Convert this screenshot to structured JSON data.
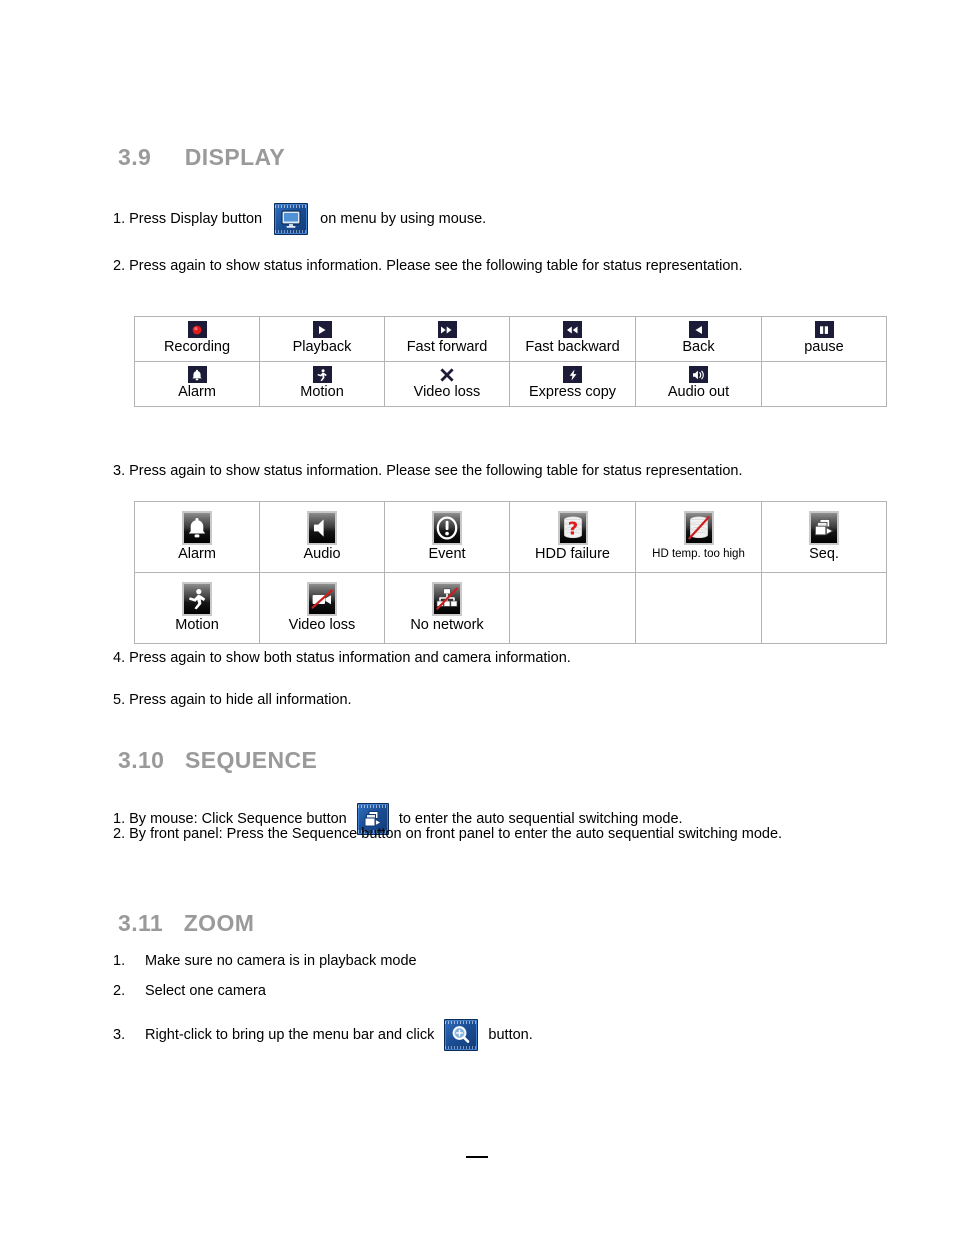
{
  "sections": {
    "display": {
      "number": "3.9",
      "title": "DISPLAY",
      "steps": {
        "s1_pre": "1. Press Display button",
        "s1_post": "on menu by using mouse.",
        "s2": "2. Press again to show status information. Please see the following table for status representation.",
        "s3": "3. Press again to show status information. Please see the following table for status representation.",
        "s4": "4. Press again to show both status information and camera information.",
        "s5": "5. Press again to hide all information."
      }
    },
    "sequence": {
      "number": "3.10",
      "title": "SEQUENCE",
      "steps": {
        "s1_pre": "1. By mouse: Click Sequence button",
        "s1_post": "to enter the auto sequential switching mode.",
        "s2": "2. By front panel: Press the Sequence button on front panel to enter the auto sequential switching mode."
      }
    },
    "zoom": {
      "number": "3.11",
      "title": "ZOOM",
      "steps": [
        {
          "marker": "1.",
          "text": "Make sure no camera is in playback mode"
        },
        {
          "marker": "2.",
          "text": "Select one camera"
        },
        {
          "marker": "3.",
          "pre": "Right-click to bring up the menu bar and click",
          "post": "button."
        }
      ]
    }
  },
  "table_status_1": {
    "rows": [
      [
        {
          "icon": "record-dot-icon",
          "label": "Recording"
        },
        {
          "icon": "play-icon",
          "label": "Playback"
        },
        {
          "icon": "fast-forward-icon",
          "label": "Fast forward"
        },
        {
          "icon": "fast-backward-icon",
          "label": "Fast backward"
        },
        {
          "icon": "back-icon",
          "label": "Back"
        },
        {
          "icon": "pause-icon",
          "label": "pause"
        }
      ],
      [
        {
          "icon": "bell-icon",
          "label": "Alarm"
        },
        {
          "icon": "motion-person-icon",
          "label": "Motion"
        },
        {
          "icon": "x-cross-icon",
          "label": "Video loss"
        },
        {
          "icon": "lightning-icon",
          "label": "Express copy"
        },
        {
          "icon": "speaker-icon",
          "label": "Audio out"
        },
        {
          "icon": "",
          "label": ""
        }
      ]
    ]
  },
  "table_status_2": {
    "rows": [
      [
        {
          "icon": "bell-icon",
          "label": "Alarm"
        },
        {
          "icon": "speaker-icon",
          "label": "Audio"
        },
        {
          "icon": "exclamation-circle-icon",
          "label": "Event"
        },
        {
          "icon": "hdd-question-icon",
          "label": "HDD failure"
        },
        {
          "icon": "hdd-slash-icon",
          "label": "HD temp. too high",
          "small": true
        },
        {
          "icon": "sequence-icon",
          "label": "Seq."
        }
      ],
      [
        {
          "icon": "motion-person-icon",
          "label": "Motion"
        },
        {
          "icon": "camera-slash-icon",
          "label": "Video loss"
        },
        {
          "icon": "network-slash-icon",
          "label": "No network"
        },
        {
          "icon": "",
          "label": ""
        },
        {
          "icon": "",
          "label": ""
        },
        {
          "icon": "",
          "label": ""
        }
      ]
    ]
  },
  "inline_icons": {
    "display_button": "monitor-icon",
    "sequence_button": "sequence-icon",
    "zoom_button": "magnifier-plus-icon"
  },
  "colors": {
    "heading": "#9a9a9a",
    "icon_navy": "#1c1c38",
    "icon_red": "#e01b1b",
    "table_border": "#b4b4b4",
    "button_blue": "#1b4e96"
  },
  "footer": {
    "dash": "—"
  }
}
